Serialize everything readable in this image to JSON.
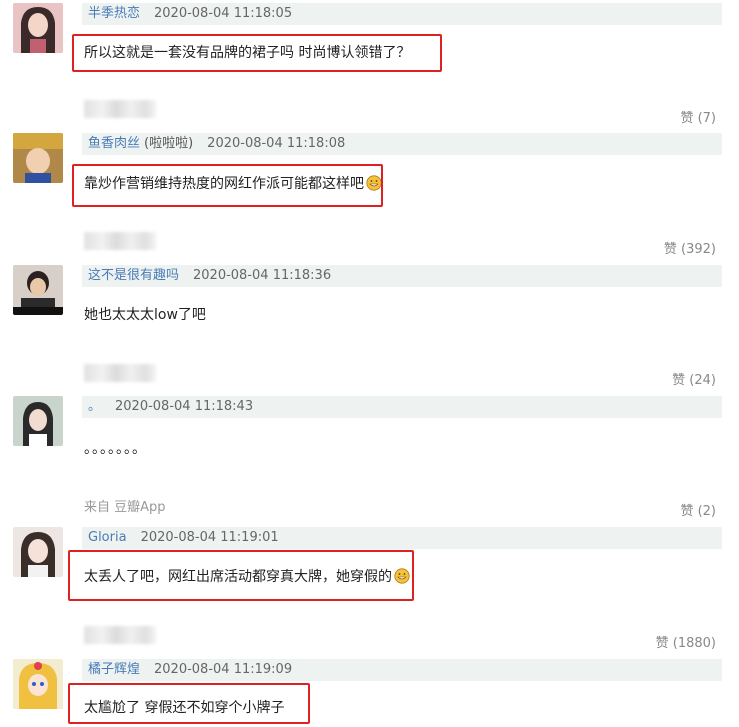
{
  "comments": [
    {
      "username": "半季热恋",
      "tag": "",
      "time": "2020-08-04 11:18:05",
      "content": "所以这就是一套没有品牌的裙子吗 时尚博认领错了？",
      "likes": "赞 (7)",
      "source": ""
    },
    {
      "username": "鱼香肉丝",
      "tag": "(啦啦啦)",
      "time": "2020-08-04 11:18:08",
      "content": "靠炒作营销维持热度的网红作派可能都这样吧",
      "likes": "赞 (392)",
      "source": ""
    },
    {
      "username": "这不是很有趣吗",
      "tag": "",
      "time": "2020-08-04 11:18:36",
      "content": "她也太太太low了吧",
      "likes": "赞 (24)",
      "source": ""
    },
    {
      "username": "。",
      "tag": "",
      "time": "2020-08-04 11:18:43",
      "content": "。。。。。。。",
      "likes": "赞 (2)",
      "source": "来自 豆瓣App"
    },
    {
      "username": "Gloria",
      "tag": "",
      "time": "2020-08-04 11:19:01",
      "content": "太丢人了吧，网红出席活动都穿真大牌，她穿假的",
      "likes": "赞 (1880)",
      "source": ""
    },
    {
      "username": "橘子辉煌",
      "tag": "",
      "time": "2020-08-04 11:19:09",
      "content": "太尴尬了 穿假还不如穿个小牌子",
      "likes": "",
      "source": ""
    }
  ],
  "colors": {
    "highlight": "#e02121",
    "username": "#4a7bb5",
    "meta_bg": "#eef3f2"
  },
  "icons": [
    "avatar-image",
    "grin-emoji-icon"
  ]
}
